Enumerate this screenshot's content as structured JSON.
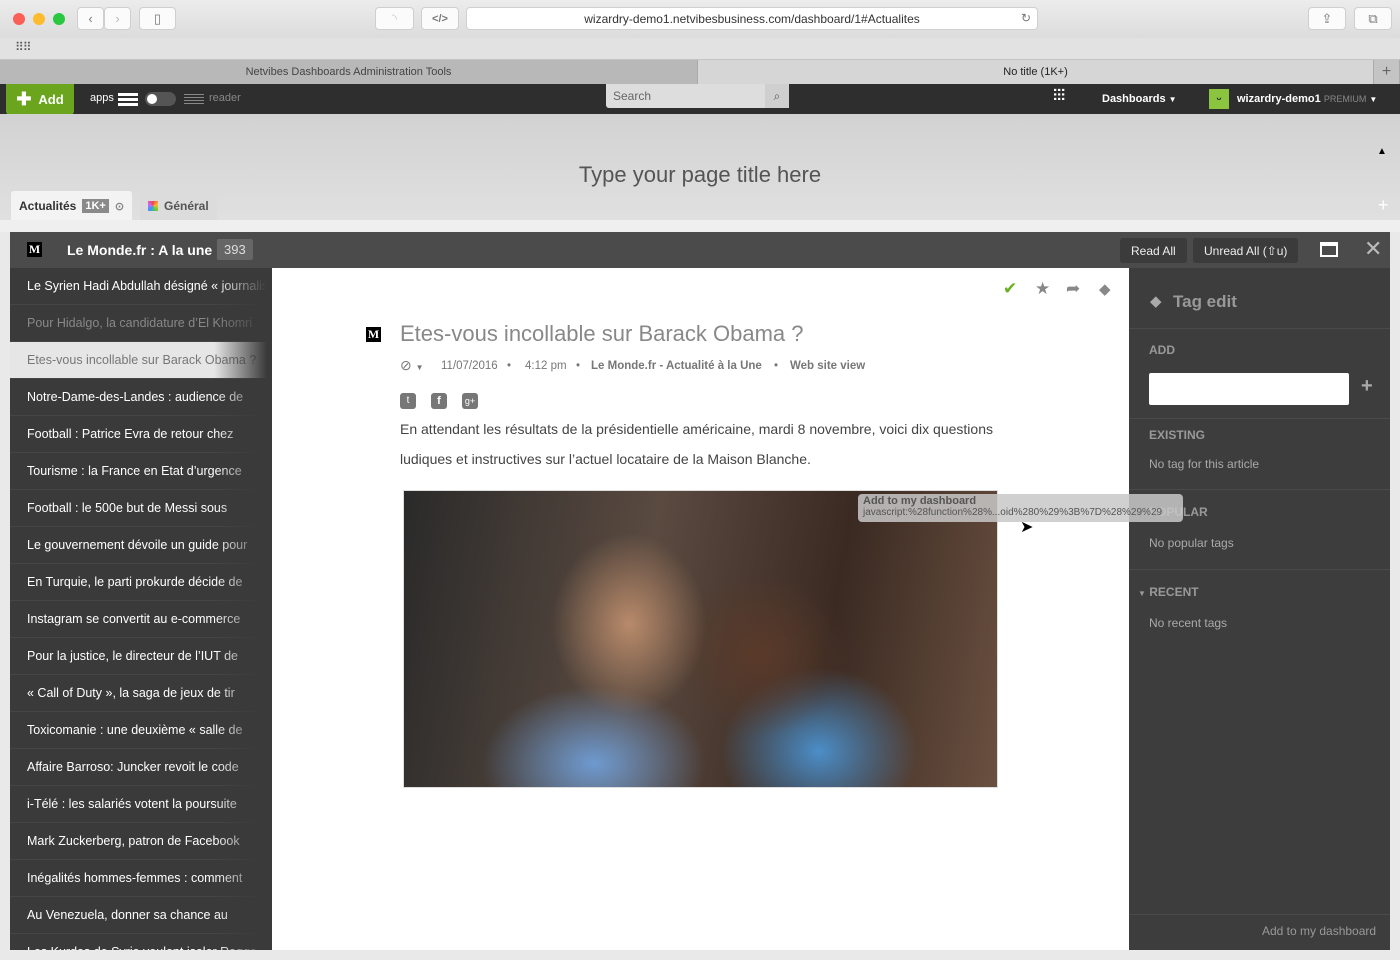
{
  "browser": {
    "url": "wizardry-demo1.netvibesbusiness.com/dashboard/1#Actualites",
    "tabs": [
      {
        "label": "Netvibes Dashboards Administration Tools",
        "active": false
      },
      {
        "label": "No title (1K+)",
        "active": true
      }
    ]
  },
  "topbar": {
    "add_label": "Add",
    "apps_label": "apps",
    "reader_label": "reader",
    "search_placeholder": "Search",
    "dashboards_label": "Dashboards",
    "user_name": "wizardry-demo1",
    "user_plan": "PREMIUM",
    "brand_color": "#6aa51d"
  },
  "page": {
    "title_placeholder": "Type your page title here",
    "tabs": [
      {
        "label": "Actualités",
        "badge": "1K+",
        "active": true
      },
      {
        "label": "Général",
        "active": false
      }
    ]
  },
  "widget": {
    "title": "Le Monde.fr : A la une",
    "count": "393",
    "read_all": "Read All",
    "unread_all": "Unread All (⇧u)"
  },
  "articles": [
    {
      "title": "Le Syrien Hadi Abdullah désigné « journaliste",
      "state": "unread"
    },
    {
      "title": "Pour Hidalgo, la candidature d’El Khomri",
      "state": "read"
    },
    {
      "title": "Etes-vous incollable sur Barack Obama ?",
      "state": "selected"
    },
    {
      "title": "Notre-Dame-des-Landes : audience de",
      "state": "unread"
    },
    {
      "title": "Football : Patrice Evra de retour chez",
      "state": "unread"
    },
    {
      "title": "Tourisme : la France en Etat d’urgence",
      "state": "unread"
    },
    {
      "title": "Football : le 500e but de Messi sous",
      "state": "unread"
    },
    {
      "title": "Le gouvernement dévoile un guide pour",
      "state": "unread"
    },
    {
      "title": "En Turquie, le parti prokurde décide de",
      "state": "unread"
    },
    {
      "title": "Instagram se convertit au e-commerce",
      "state": "unread"
    },
    {
      "title": "Pour la justice, le directeur de l’IUT de",
      "state": "unread"
    },
    {
      "title": "« Call of Duty », la saga de jeux de tir",
      "state": "unread"
    },
    {
      "title": "Toxicomanie : une deuxième « salle de",
      "state": "unread"
    },
    {
      "title": "Affaire Barroso: Juncker revoit le code",
      "state": "unread"
    },
    {
      "title": "i-Télé : les salariés votent la poursuite",
      "state": "unread"
    },
    {
      "title": "Mark Zuckerberg, patron de Facebook",
      "state": "unread"
    },
    {
      "title": "Inégalités hommes-femmes : comment",
      "state": "unread"
    },
    {
      "title": "Au Venezuela, donner sa chance au",
      "state": "unread"
    },
    {
      "title": "Les Kurdes de Syrie veulent isoler Raqqa",
      "state": "unread"
    }
  ],
  "article": {
    "title": "Etes-vous incollable sur Barack Obama ?",
    "date": "11/07/2016",
    "time": "4:12 pm",
    "source": "Le Monde.fr - Actualité à la Une",
    "web_view": "Web site view",
    "body_line1": "En attendant les résultats de la présidentielle américaine, mardi 8 novembre, voici dix questions",
    "body_line2": "ludiques et instructives sur l’actuel locataire de la Maison Blanche."
  },
  "tooltip": {
    "title": "Add to my dashboard",
    "url": "javascript:%28function%28%...oid%280%29%3B%7D%28%29%29"
  },
  "tag_panel": {
    "title": "Tag edit",
    "add_label": "ADD",
    "existing_label": "EXISTING",
    "existing_note": "No tag for this article",
    "popular_label": "POPULAR",
    "popular_note": "No popular tags",
    "recent_label": "RECENT",
    "recent_note": "No recent tags",
    "footer": "Add to my dashboard"
  }
}
